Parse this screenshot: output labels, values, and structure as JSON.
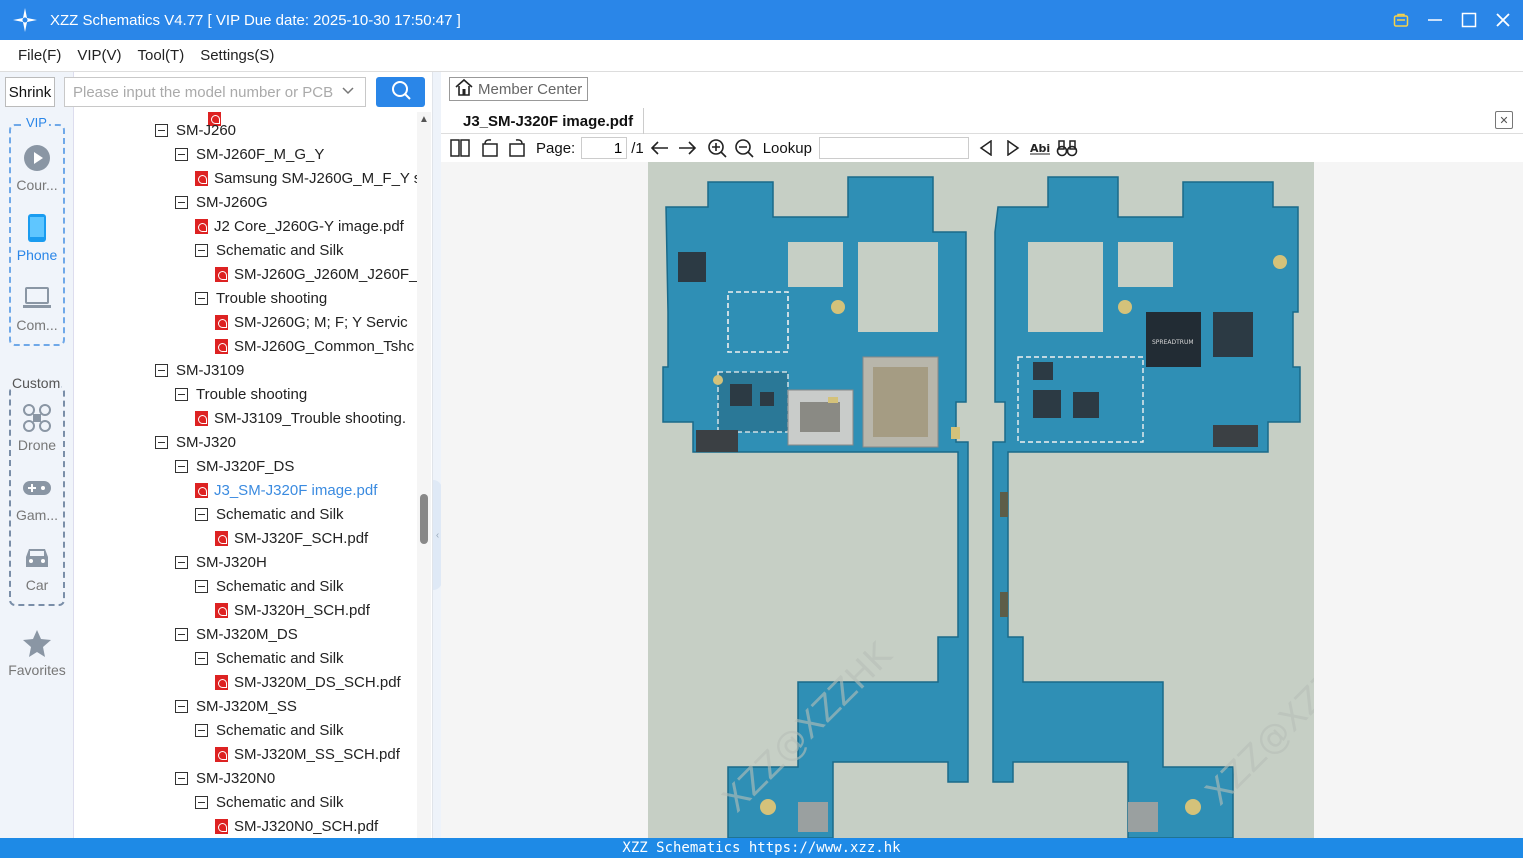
{
  "window": {
    "title": "XZZ Schematics V4.77 [ VIP Due date: 2025-10-30 17:50:47 ]"
  },
  "menu": [
    "File(F)",
    "VIP(V)",
    "Tool(T)",
    "Settings(S)"
  ],
  "search": {
    "shrink_label": "Shrink",
    "placeholder": "Please input the model number or PCB"
  },
  "rail": {
    "vip_label": "VIP",
    "custom_label": "Custom",
    "items": [
      {
        "label": "Cour...",
        "icon": "play-circle-icon"
      },
      {
        "label": "Phone",
        "icon": "phone-icon",
        "active": true
      },
      {
        "label": "Com...",
        "icon": "laptop-icon"
      },
      {
        "label": "Drone",
        "icon": "drone-icon"
      },
      {
        "label": "Gam...",
        "icon": "gamepad-icon"
      },
      {
        "label": "Car",
        "icon": "car-icon"
      },
      {
        "label": "Favorites",
        "icon": "star-icon"
      }
    ]
  },
  "tree": [
    {
      "label": "SM-J260",
      "type": "folder",
      "depth": 0
    },
    {
      "label": "SM-J260F_M_G_Y",
      "type": "folder",
      "depth": 1
    },
    {
      "label": "Samsung SM-J260G_M_F_Y s",
      "type": "pdf",
      "depth": 2
    },
    {
      "label": "SM-J260G",
      "type": "folder",
      "depth": 1
    },
    {
      "label": "J2 Core_J260G-Y image.pdf",
      "type": "pdf",
      "depth": 2
    },
    {
      "label": "Schematic and Silk",
      "type": "folder",
      "depth": 2
    },
    {
      "label": "SM-J260G_J260M_J260F_J",
      "type": "pdf",
      "depth": 3
    },
    {
      "label": "Trouble shooting",
      "type": "folder",
      "depth": 2
    },
    {
      "label": "SM-J260G; M; F; Y   Servic",
      "type": "pdf",
      "depth": 3
    },
    {
      "label": "SM-J260G_Common_Tshc",
      "type": "pdf",
      "depth": 3
    },
    {
      "label": "SM-J3109",
      "type": "folder",
      "depth": 0
    },
    {
      "label": "Trouble shooting",
      "type": "folder",
      "depth": 1
    },
    {
      "label": "SM-J3109_Trouble shooting.",
      "type": "pdf",
      "depth": 2
    },
    {
      "label": "SM-J320",
      "type": "folder",
      "depth": 0
    },
    {
      "label": "SM-J320F_DS",
      "type": "folder",
      "depth": 1
    },
    {
      "label": "J3_SM-J320F image.pdf",
      "type": "pdf",
      "depth": 2,
      "selected": true
    },
    {
      "label": "Schematic and Silk",
      "type": "folder",
      "depth": 2
    },
    {
      "label": "SM-J320F_SCH.pdf",
      "type": "pdf",
      "depth": 3
    },
    {
      "label": "SM-J320H",
      "type": "folder",
      "depth": 1
    },
    {
      "label": "Schematic and Silk",
      "type": "folder",
      "depth": 2
    },
    {
      "label": "SM-J320H_SCH.pdf",
      "type": "pdf",
      "depth": 3
    },
    {
      "label": "SM-J320M_DS",
      "type": "folder",
      "depth": 1
    },
    {
      "label": "Schematic and Silk",
      "type": "folder",
      "depth": 2
    },
    {
      "label": "SM-J320M_DS_SCH.pdf",
      "type": "pdf",
      "depth": 3
    },
    {
      "label": "SM-J320M_SS",
      "type": "folder",
      "depth": 1
    },
    {
      "label": "Schematic and Silk",
      "type": "folder",
      "depth": 2
    },
    {
      "label": "SM-J320M_SS_SCH.pdf",
      "type": "pdf",
      "depth": 3
    },
    {
      "label": "SM-J320N0",
      "type": "folder",
      "depth": 1
    },
    {
      "label": "Schematic and Silk",
      "type": "folder",
      "depth": 2
    },
    {
      "label": "SM-J320N0_SCH.pdf",
      "type": "pdf",
      "depth": 3
    }
  ],
  "viewer": {
    "member_center": "Member Center",
    "tab": "J3_SM-J320F image.pdf",
    "page_label": "Page:",
    "page_current": "1",
    "page_total": "/1",
    "lookup_label": "Lookup",
    "watermark": "XZZ@XZZHK",
    "chip_label": "SPREADTRUM"
  },
  "status": "XZZ Schematics https://www.xzz.hk",
  "colors": {
    "accent": "#2a86e8",
    "pcb": "#2f8fb5",
    "page_bg": "#c6cfc5"
  }
}
